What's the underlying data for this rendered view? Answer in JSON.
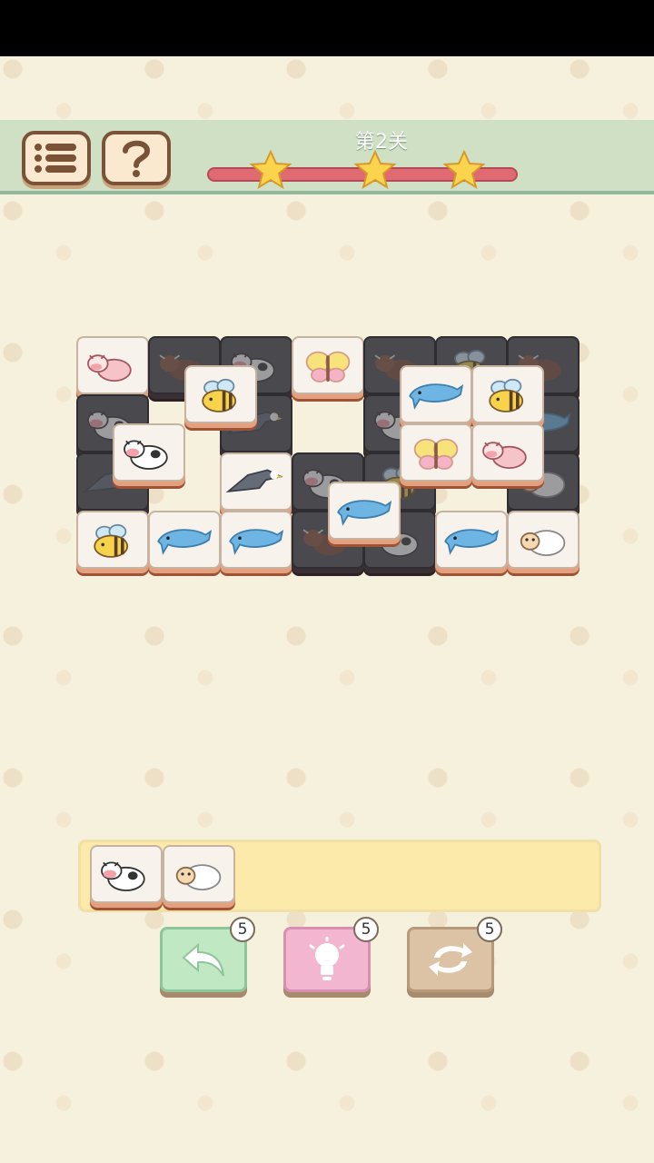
{
  "level": {
    "title": "第2关",
    "stars": 3
  },
  "toolbar": {
    "menu_icon": "list-icon",
    "help_icon": "question-icon"
  },
  "tiles": [
    {
      "animal": "cow-pink",
      "layer": "bottom",
      "col": 0,
      "row": 0,
      "covered": false
    },
    {
      "animal": "bull-brown",
      "layer": "bottom",
      "col": 1,
      "row": 0,
      "covered": true
    },
    {
      "animal": "cow",
      "layer": "bottom",
      "col": 2,
      "row": 0,
      "covered": true
    },
    {
      "animal": "butterfly",
      "layer": "bottom",
      "col": 3,
      "row": 0,
      "covered": false
    },
    {
      "animal": "bull-brown",
      "layer": "bottom",
      "col": 4,
      "row": 0,
      "covered": true
    },
    {
      "animal": "bee",
      "layer": "bottom",
      "col": 5,
      "row": 0,
      "covered": true
    },
    {
      "animal": "bull-brown",
      "layer": "bottom",
      "col": 6,
      "row": 0,
      "covered": true
    },
    {
      "animal": "cow",
      "layer": "bottom",
      "col": 0,
      "row": 1,
      "covered": true
    },
    {
      "animal": "eagle",
      "layer": "bottom",
      "col": 2,
      "row": 1,
      "covered": true
    },
    {
      "animal": "cow",
      "layer": "bottom",
      "col": 4,
      "row": 1,
      "covered": true
    },
    {
      "animal": "dolphin",
      "layer": "bottom",
      "col": 6,
      "row": 1,
      "covered": true
    },
    {
      "animal": "eagle",
      "layer": "bottom",
      "col": 0,
      "row": 2,
      "covered": true
    },
    {
      "animal": "eagle",
      "layer": "bottom",
      "col": 2,
      "row": 2,
      "covered": false
    },
    {
      "animal": "cow",
      "layer": "bottom",
      "col": 3,
      "row": 2,
      "covered": true
    },
    {
      "animal": "bee",
      "layer": "bottom",
      "col": 4,
      "row": 2,
      "covered": true
    },
    {
      "animal": "sheep",
      "layer": "bottom",
      "col": 6,
      "row": 2,
      "covered": true
    },
    {
      "animal": "bee",
      "layer": "bottom",
      "col": 0,
      "row": 3,
      "covered": false
    },
    {
      "animal": "dolphin",
      "layer": "bottom",
      "col": 1,
      "row": 3,
      "covered": false
    },
    {
      "animal": "dolphin",
      "layer": "bottom",
      "col": 2,
      "row": 3,
      "covered": false
    },
    {
      "animal": "bull-brown",
      "layer": "bottom",
      "col": 3,
      "row": 3,
      "covered": true
    },
    {
      "animal": "cow",
      "layer": "bottom",
      "col": 4,
      "row": 3,
      "covered": true
    },
    {
      "animal": "dolphin",
      "layer": "bottom",
      "col": 5,
      "row": 3,
      "covered": false
    },
    {
      "animal": "sheep",
      "layer": "bottom",
      "col": 6,
      "row": 3,
      "covered": false
    },
    {
      "animal": "bee",
      "layer": "top",
      "col": 1.5,
      "row": 0.5,
      "covered": false
    },
    {
      "animal": "dolphin",
      "layer": "top",
      "col": 4.5,
      "row": 0.5,
      "covered": false
    },
    {
      "animal": "bee",
      "layer": "top",
      "col": 5.5,
      "row": 0.5,
      "covered": false
    },
    {
      "animal": "cow",
      "layer": "top",
      "col": 0.5,
      "row": 1.5,
      "covered": false
    },
    {
      "animal": "butterfly",
      "layer": "top",
      "col": 4.5,
      "row": 1.5,
      "covered": false
    },
    {
      "animal": "cow-pink",
      "layer": "top",
      "col": 5.5,
      "row": 1.5,
      "covered": false
    },
    {
      "animal": "dolphin",
      "layer": "top",
      "col": 3.5,
      "row": 2.5,
      "covered": false
    }
  ],
  "tray": [
    "cow",
    "sheep"
  ],
  "tools": [
    {
      "name": "undo",
      "icon": "undo-icon",
      "count": "5",
      "color": "#bfe8c3"
    },
    {
      "name": "hint",
      "icon": "lightbulb-icon",
      "count": "5",
      "color": "#f3b6d1"
    },
    {
      "name": "shuffle",
      "icon": "shuffle-icon",
      "count": "5",
      "color": "#dcc3a5"
    }
  ]
}
